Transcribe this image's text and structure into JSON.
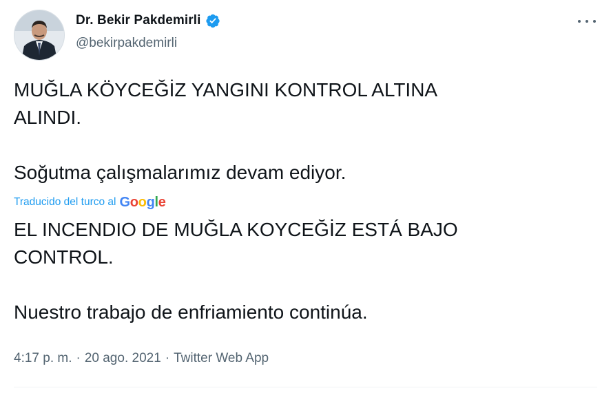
{
  "author": {
    "name": "Dr. Bekir Pakdemirli",
    "handle": "@bekirpakdemirli",
    "verified_icon": "verified-badge-icon"
  },
  "tweet": {
    "text": "MUĞLA KÖYCEĞİZ YANGINI KONTROL ALTINA\nALINDI.\n\nSoğutma çalışmalarımız devam ediyor."
  },
  "translation": {
    "label": "Traducido del turco al",
    "provider": {
      "letters": [
        "G",
        "o",
        "o",
        "g",
        "l",
        "e"
      ],
      "colors": [
        "#4285F4",
        "#EA4335",
        "#FBBC05",
        "#4285F4",
        "#34A853",
        "#EA4335"
      ]
    },
    "text": "EL INCENDIO DE MUĞLA KOYCEĞİZ ESTÁ BAJO\nCONTROL.\n\n Nuestro trabajo de enfriamiento continúa."
  },
  "meta": {
    "time": "4:17 p. m.",
    "sep1": "·",
    "date": "20 ago. 2021",
    "sep2": "·",
    "source": "Twitter Web App"
  },
  "colors": {
    "accent": "#1d9bf0",
    "text": "#0f1419",
    "secondary": "#536471"
  }
}
